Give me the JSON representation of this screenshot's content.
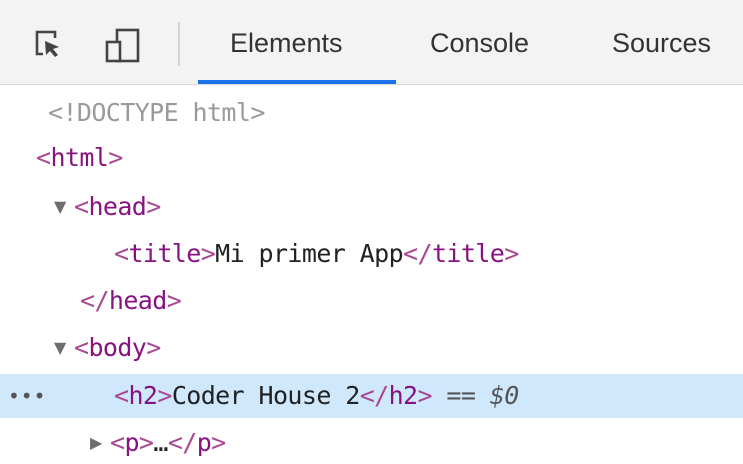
{
  "toolbar": {
    "inspect_icon": "inspect-element-icon",
    "device_icon": "device-toolbar-icon",
    "tabs": [
      {
        "label": "Elements",
        "active": true
      },
      {
        "label": "Console",
        "active": false
      },
      {
        "label": "Sources",
        "active": false
      }
    ],
    "accent_color": "#1a73e8"
  },
  "tree": {
    "doctype": "<!DOCTYPE html>",
    "html_open": "html",
    "head_open": "head",
    "title_tag": "title",
    "title_text": "Mi primer App",
    "head_close": "head",
    "body_open": "body",
    "h2_tag": "h2",
    "h2_text": "Coder House 2",
    "selected_marker": "== $0",
    "p_tag": "p",
    "p_ellipsis": "…",
    "gutter_dots": "•••",
    "selected_row_color": "#cfe8fc"
  }
}
